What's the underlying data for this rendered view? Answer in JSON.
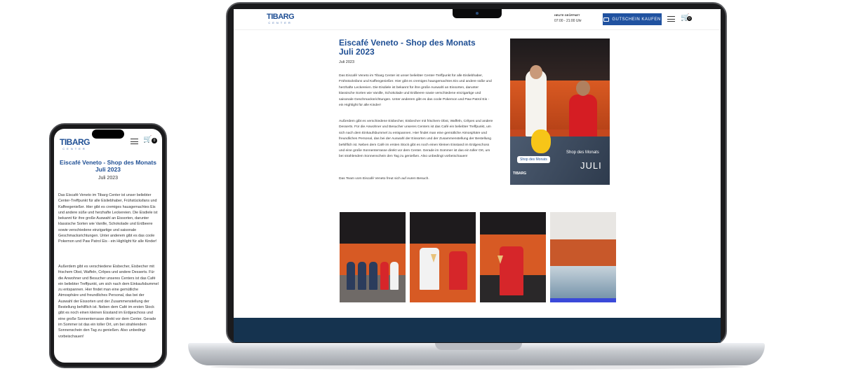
{
  "brand": {
    "logo_text": "TIBARG",
    "logo_sub": "CENTER",
    "primary": "#1f4f94",
    "button": "#2052a0",
    "footer": "#15334f"
  },
  "header": {
    "hours_label": "HEUTE GEÖFFNET",
    "hours_value": "07:00 - 21:00 Uhr",
    "voucher_label": "GUTSCHEIN KAUFEN",
    "cart_count": "0"
  },
  "article": {
    "title": "Eiscafé Veneto - Shop des Monats Juli 2023",
    "date": "Juli 2023",
    "paragraphs": [
      "Das Eiscafé Veneto im Tibarg Center ist unser beliebter Center-Treffpunkt für alle Eisliebhaber, Frühstücksfans und Kaffeegenießer. Hier gibt es cremiges hausgemachtes Eis und andere süße und herzhafte Leckereien. Die Eisdiele ist bekannt für ihre große Auswahl an Eissorten, darunter klassische Sorten wie Vanille, Schokolade und Erdbeere sowie verschiedene einzigartige und saisonale Geschmacksrichtungen. Unter anderem gibt es das coole Pokemon und Paw Patrol Eis - ein Highlight für alle Kinder!",
      "Außerdem gibt es verschiedene Eisbecher, Eisbecher mit frischem Obst, Waffeln, Crêpes und andere Desserts. Für die Anwohner und Besucher unseres Centers ist das Café ein beliebter Treffpunkt, um sich nach dem Einkaufsbummel zu entspannen. Hier findet man eine gemütliche Atmosphäre und freundliches Personal, das bei der Auswahl der Eissorten und der Zusammenstellung der Bestellung behilflich ist. Neben dem Café im ersten Stock gibt es noch einen kleinen Eisstand im Erdgeschoss und eine große Sonnenterrasse direkt vor dem Center. Gerade im Sommer ist das ein toller Ort, um bei strahlendem Sonnenschein den Tag zu genießen. Also unbedingt vorbeischauen!",
      "Das Team vom Eiscafé Veneto freut sich auf euren Besuch."
    ]
  },
  "hero_image": {
    "badge": "Shop des Monats",
    "line1": "Shop des Monats",
    "line2": "JULI",
    "logo": "TIBARG"
  }
}
